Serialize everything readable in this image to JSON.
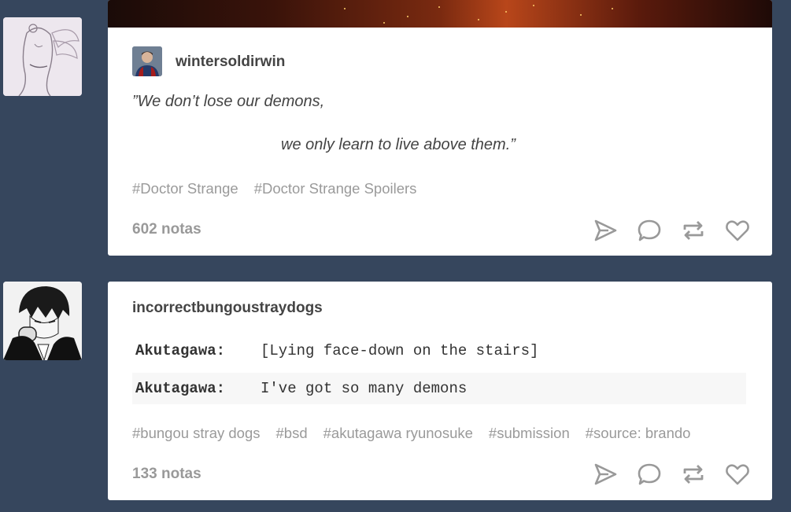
{
  "posts": [
    {
      "username": "wintersoldirwin",
      "quote_line1": "”We don’t lose our demons,",
      "quote_line2": "we only learn to live above them.”",
      "tags": [
        "#Doctor Strange",
        "#Doctor Strange Spoilers"
      ],
      "notes": "602 notas",
      "icons": [
        "send-icon",
        "comment-icon",
        "reblog-icon",
        "heart-icon"
      ]
    },
    {
      "username": "incorrectbungoustraydogs",
      "chat": [
        {
          "speaker": "Akutagawa:",
          "line": "[Lying face-down on the stairs]"
        },
        {
          "speaker": "Akutagawa:",
          "line": "I've got so many demons"
        }
      ],
      "tags": [
        "#bungou stray dogs",
        "#bsd",
        "#akutagawa ryunosuke",
        "#submission",
        "#source: brando"
      ],
      "notes": "133 notas",
      "icons": [
        "send-icon",
        "comment-icon",
        "reblog-icon",
        "heart-icon"
      ]
    }
  ],
  "colors": {
    "background": "#36465d",
    "card": "#ffffff",
    "tag": "#9a9a9a",
    "icon": "#999999"
  }
}
